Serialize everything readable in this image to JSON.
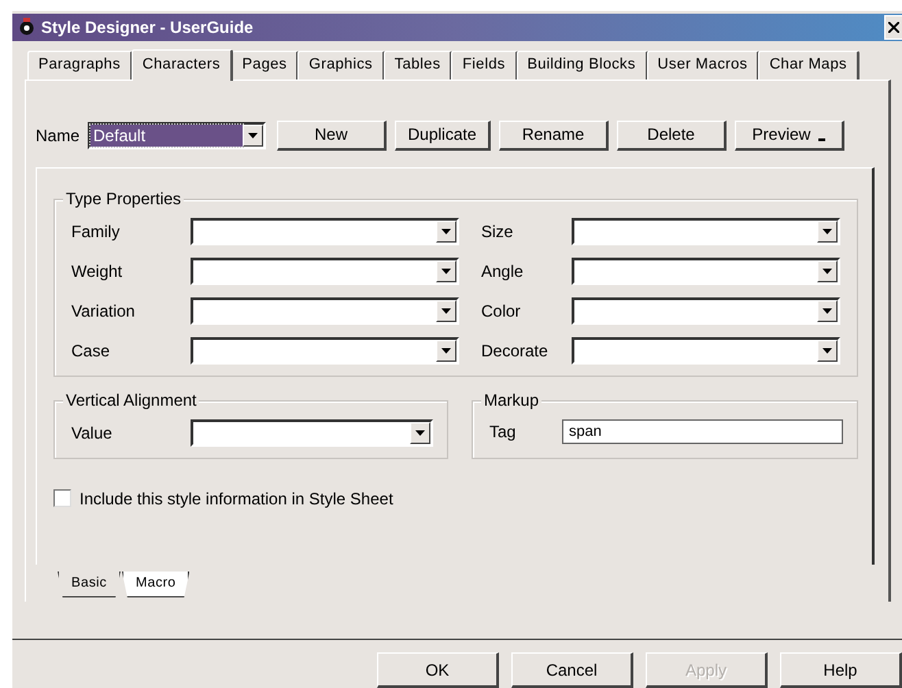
{
  "window": {
    "title": "Style Designer - UserGuide"
  },
  "tabs": [
    {
      "label": "Paragraphs",
      "selected": false
    },
    {
      "label": "Characters",
      "selected": true
    },
    {
      "label": "Pages",
      "selected": false
    },
    {
      "label": "Graphics",
      "selected": false
    },
    {
      "label": "Tables",
      "selected": false
    },
    {
      "label": "Fields",
      "selected": false
    },
    {
      "label": "Building Blocks",
      "selected": false
    },
    {
      "label": "User Macros",
      "selected": false
    },
    {
      "label": "Char Maps",
      "selected": false
    }
  ],
  "name_row": {
    "label": "Name",
    "value": "Default",
    "buttons": [
      {
        "label": "New",
        "menu": false
      },
      {
        "label": "Duplicate",
        "menu": false
      },
      {
        "label": "Rename",
        "menu": false
      },
      {
        "label": "Delete",
        "menu": false
      },
      {
        "label": "Preview",
        "menu": true
      }
    ]
  },
  "type_properties": {
    "title": "Type Properties",
    "left": [
      {
        "label": "Family"
      },
      {
        "label": "Weight"
      },
      {
        "label": "Variation"
      },
      {
        "label": "Case"
      }
    ],
    "right": [
      {
        "label": "Size"
      },
      {
        "label": "Angle"
      },
      {
        "label": "Color"
      },
      {
        "label": "Decorate"
      }
    ]
  },
  "vertical_alignment": {
    "title": "Vertical Alignment",
    "label": "Value"
  },
  "markup": {
    "title": "Markup",
    "label": "Tag",
    "value": "span"
  },
  "include_checkbox": {
    "label": "Include this style information in Style Sheet",
    "checked": false
  },
  "sub_tabs": [
    {
      "label": "Basic",
      "selected": true
    },
    {
      "label": "Macro",
      "selected": false
    }
  ],
  "buttons": [
    {
      "label": "OK",
      "disabled": false
    },
    {
      "label": "Cancel",
      "disabled": false
    },
    {
      "label": "Apply",
      "disabled": true
    },
    {
      "label": "Help",
      "disabled": false
    }
  ]
}
